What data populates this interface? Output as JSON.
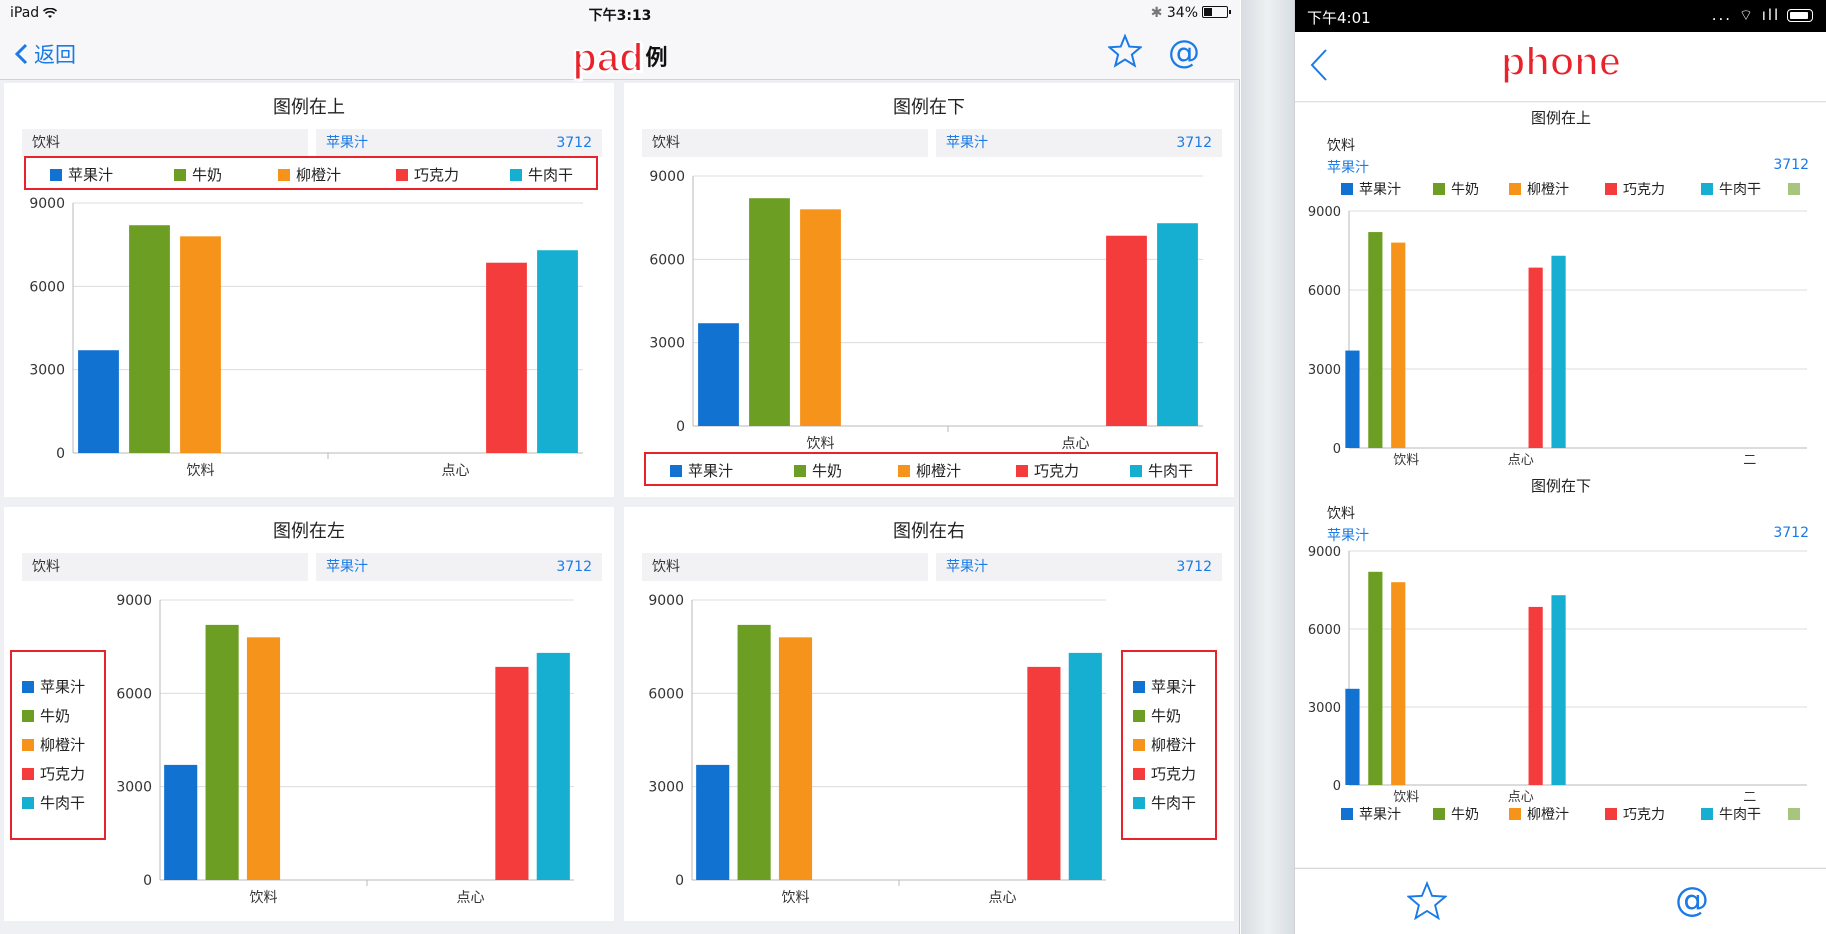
{
  "colors": {
    "accent": "#1a7ae6",
    "highlight": "#e8232b",
    "series": [
      "#1172d1",
      "#6d9e24",
      "#f6931a",
      "#f53c3c",
      "#16aed1"
    ]
  },
  "pad_status": {
    "device": "iPad",
    "time": "下午3:13",
    "battery": "34%"
  },
  "pad_nav": {
    "back": "返回",
    "title_stamp": "pad",
    "title": "例",
    "icons": [
      "star-icon",
      "at-icon"
    ]
  },
  "phone_status": {
    "time": "下午4:01",
    "indicators": "... ⌔ ıll"
  },
  "phone_nav": {
    "title_stamp": "phone",
    "icons": [
      "chevron-left-icon"
    ]
  },
  "phone_tabbar": {
    "icons": [
      "star-icon",
      "at-icon"
    ],
    "at": "@"
  },
  "header_row": {
    "label": "饮料",
    "selected": "苹果汁",
    "value": "3712"
  },
  "legend": [
    "苹果汁",
    "牛奶",
    "柳橙汁",
    "巧克力",
    "牛肉干"
  ],
  "pad_panels": [
    {
      "title": "图例在上",
      "legend_position": "top"
    },
    {
      "title": "图例在下",
      "legend_position": "bottom"
    },
    {
      "title": "图例在左",
      "legend_position": "left"
    },
    {
      "title": "图例在右",
      "legend_position": "right"
    }
  ],
  "phone_panels": [
    {
      "title": "图例在上",
      "legend_position": "top"
    },
    {
      "title": "图例在下",
      "legend_position": "bottom"
    }
  ],
  "chart_data": [
    {
      "type": "bar",
      "title": "图例在上",
      "categories": [
        "饮料",
        "点心"
      ],
      "series": [
        {
          "name": "苹果汁",
          "values": [
            3700,
            null
          ]
        },
        {
          "name": "牛奶",
          "values": [
            8200,
            null
          ]
        },
        {
          "name": "柳橙汁",
          "values": [
            7800,
            null
          ]
        },
        {
          "name": "巧克力",
          "values": [
            null,
            6850
          ]
        },
        {
          "name": "牛肉干",
          "values": [
            null,
            7300
          ]
        }
      ],
      "yticks": [
        "0",
        "3000",
        "6000",
        "9000"
      ],
      "ylim": [
        0,
        9000
      ],
      "legend": "top",
      "grid": true
    },
    {
      "type": "bar",
      "title": "图例在下",
      "categories": [
        "饮料",
        "点心"
      ],
      "series": [
        {
          "name": "苹果汁",
          "values": [
            3700,
            null
          ]
        },
        {
          "name": "牛奶",
          "values": [
            8200,
            null
          ]
        },
        {
          "name": "柳橙汁",
          "values": [
            7800,
            null
          ]
        },
        {
          "name": "巧克力",
          "values": [
            null,
            6850
          ]
        },
        {
          "name": "牛肉干",
          "values": [
            null,
            7300
          ]
        }
      ],
      "yticks": [
        "0",
        "3000",
        "6000",
        "9000"
      ],
      "ylim": [
        0,
        9000
      ],
      "legend": "bottom",
      "grid": true
    },
    {
      "type": "bar",
      "title": "图例在左",
      "categories": [
        "饮料",
        "点心"
      ],
      "series": [
        {
          "name": "苹果汁",
          "values": [
            3700,
            null
          ]
        },
        {
          "name": "牛奶",
          "values": [
            8200,
            null
          ]
        },
        {
          "name": "柳橙汁",
          "values": [
            7800,
            null
          ]
        },
        {
          "name": "巧克力",
          "values": [
            null,
            6850
          ]
        },
        {
          "name": "牛肉干",
          "values": [
            null,
            7300
          ]
        }
      ],
      "yticks": [
        "0",
        "3000",
        "6000",
        "9000"
      ],
      "ylim": [
        0,
        9000
      ],
      "legend": "left",
      "grid": true
    },
    {
      "type": "bar",
      "title": "图例在右",
      "categories": [
        "饮料",
        "点心"
      ],
      "series": [
        {
          "name": "苹果汁",
          "values": [
            3700,
            null
          ]
        },
        {
          "name": "牛奶",
          "values": [
            8200,
            null
          ]
        },
        {
          "name": "柳橙汁",
          "values": [
            7800,
            null
          ]
        },
        {
          "name": "巧克力",
          "values": [
            null,
            6850
          ]
        },
        {
          "name": "牛肉干",
          "values": [
            null,
            7300
          ]
        }
      ],
      "yticks": [
        "0",
        "3000",
        "6000",
        "9000"
      ],
      "ylim": [
        0,
        9000
      ],
      "legend": "right",
      "grid": true
    },
    {
      "type": "bar",
      "title": "图例在上",
      "categories": [
        "饮料",
        "点心",
        "",
        "二"
      ],
      "series": [
        {
          "name": "苹果汁",
          "values": [
            3700,
            null,
            null,
            null
          ]
        },
        {
          "name": "牛奶",
          "values": [
            8200,
            null,
            null,
            null
          ]
        },
        {
          "name": "柳橙汁",
          "values": [
            7800,
            null,
            null,
            null
          ]
        },
        {
          "name": "巧克力",
          "values": [
            null,
            6850,
            null,
            null
          ]
        },
        {
          "name": "牛肉干",
          "values": [
            null,
            7300,
            null,
            null
          ]
        }
      ],
      "yticks": [
        "0",
        "3000",
        "6000",
        "9000"
      ],
      "ylim": [
        0,
        9000
      ],
      "legend": "top",
      "grid": true
    },
    {
      "type": "bar",
      "title": "图例在下",
      "categories": [
        "饮料",
        "点心",
        "",
        "二"
      ],
      "series": [
        {
          "name": "苹果汁",
          "values": [
            3700,
            null,
            null,
            null
          ]
        },
        {
          "name": "牛奶",
          "values": [
            8200,
            null,
            null,
            null
          ]
        },
        {
          "name": "柳橙汁",
          "values": [
            7800,
            null,
            null,
            null
          ]
        },
        {
          "name": "巧克力",
          "values": [
            null,
            6850,
            null,
            null
          ]
        },
        {
          "name": "牛肉干",
          "values": [
            null,
            7300,
            null,
            null
          ]
        }
      ],
      "yticks": [
        "0",
        "3000",
        "6000",
        "9000"
      ],
      "ylim": [
        0,
        9000
      ],
      "legend": "bottom",
      "grid": true
    }
  ]
}
